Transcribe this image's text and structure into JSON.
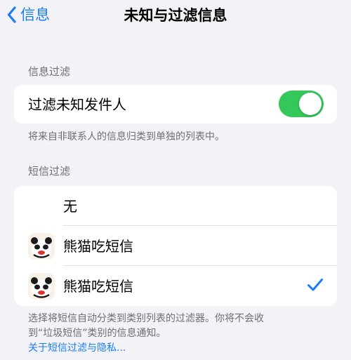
{
  "nav": {
    "back_label": "信息",
    "title": "未知与过滤信息"
  },
  "section1": {
    "header": "信息过滤",
    "toggle_row": {
      "label": "过滤未知发件人",
      "enabled": true
    },
    "footer": "将来自非联系人的信息归类到单独的列表中。"
  },
  "section2": {
    "header": "短信过滤",
    "options": [
      {
        "label": "无",
        "icon": "none",
        "selected": false
      },
      {
        "label": "熊猫吃短信",
        "icon": "panda-app-icon",
        "selected": false
      },
      {
        "label": "熊猫吃短信",
        "icon": "panda-app-icon",
        "selected": true
      }
    ],
    "footer_line1": "选择将短信自动分类到类别列表的过滤器。你将不会收",
    "footer_line2": "到“垃圾短信”类别的信息通知。",
    "link": "关于短信过滤与隐私..."
  },
  "colors": {
    "accent": "#1b7cf5",
    "toggle_on": "#34c759",
    "background": "#f2f2f7"
  }
}
